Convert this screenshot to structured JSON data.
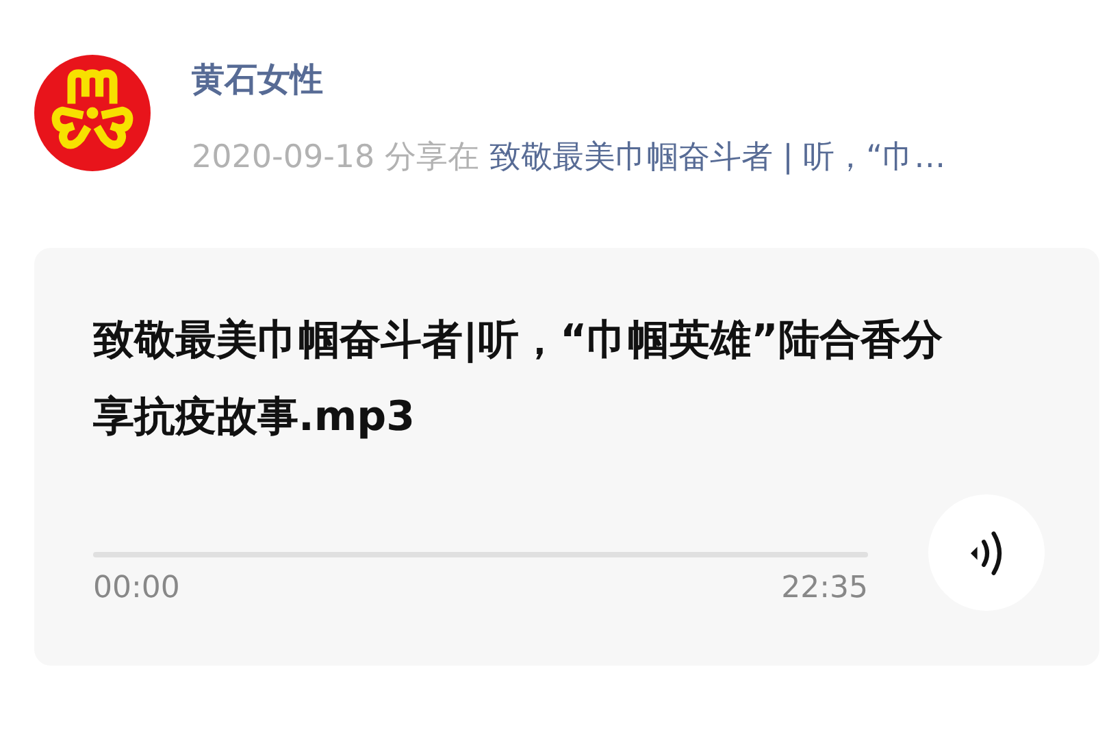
{
  "account": {
    "name": "黄石女性"
  },
  "share": {
    "date": "2020-09-18",
    "verb": "分享在",
    "link": "致敬最美巾帼奋斗者 | 听，“巾…"
  },
  "audio": {
    "title": "致敬最美巾帼奋斗者|听，“巾帼英雄”陆合香分享抗疫故事.mp3",
    "level": 0,
    "elapsed": "00:00",
    "duration": "22:35"
  }
}
